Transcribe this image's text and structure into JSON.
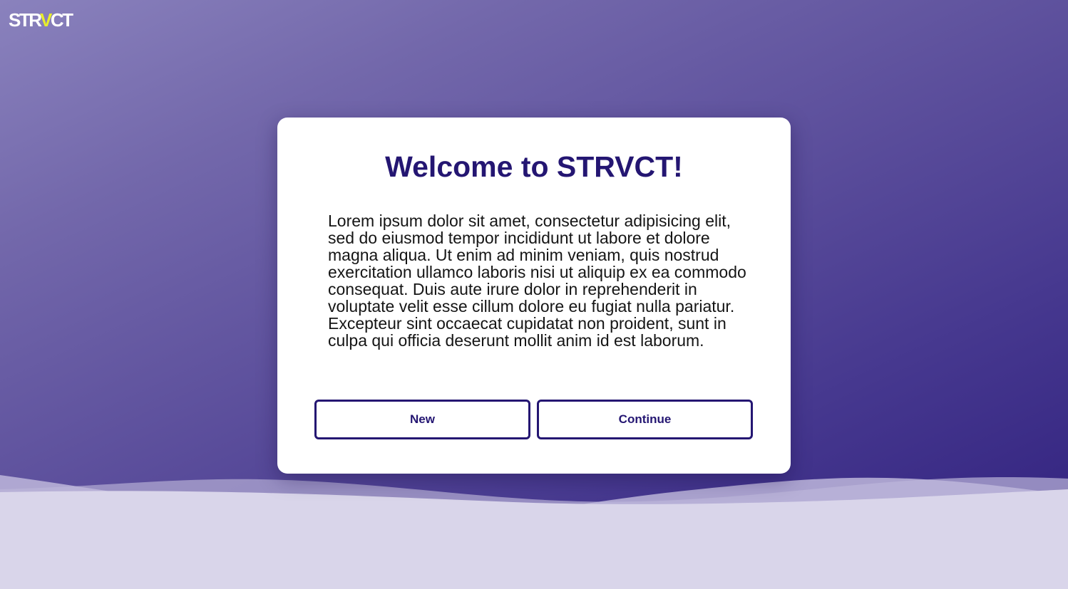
{
  "logo": {
    "prefix": "STR",
    "accent": "V",
    "suffix": "CT"
  },
  "dialog": {
    "title": "Welcome to STRVCT!",
    "body": "Lorem ipsum dolor sit amet, consectetur adipisicing elit, sed do eiusmod tempor incididunt ut labore et dolore magna aliqua. Ut enim ad minim veniam, quis nostrud exercitation ullamco laboris nisi ut aliquip ex ea commodo consequat. Duis aute irure dolor in reprehenderit in voluptate velit esse cillum dolore eu fugiat nulla pariatur. Excepteur sint occaecat cupidatat non proident, sunt in culpa qui officia deserunt mollit anim id est laborum.",
    "new_label": "New",
    "continue_label": "Continue"
  },
  "colors": {
    "brand": "#241672",
    "logo_accent": "#e8ee2b",
    "background_top": "#8a82bd",
    "background_bottom": "#2f1f7d",
    "card": "#ffffff"
  }
}
